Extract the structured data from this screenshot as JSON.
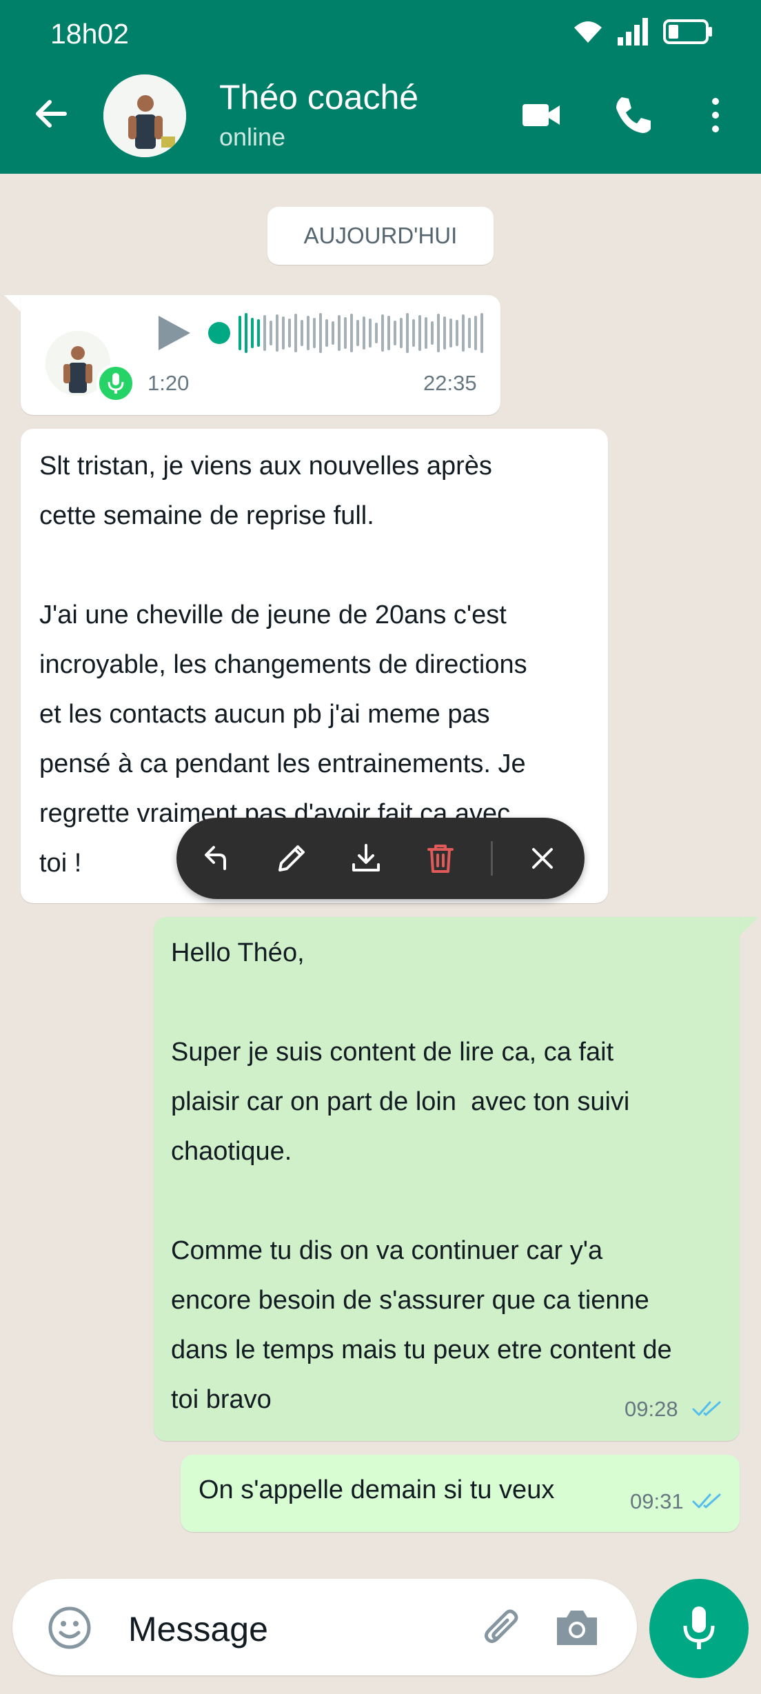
{
  "status_bar": {
    "time": "18h02"
  },
  "header": {
    "contact_name": "Théo coaché",
    "contact_status": "online"
  },
  "date_chip": "AUJOURD'HUI",
  "voice_note": {
    "duration": "1:20",
    "time": "22:35"
  },
  "messages": [
    {
      "direction": "incoming",
      "text": "Slt tristan, je viens aux nouvelles après\ncette semaine de reprise full.\n\nJ'ai une cheville de jeune de 20ans c'est\nincroyable, les changements de directions\net les contacts aucun pb j'ai meme pas\npensé à ca pendant les entrainements. Je\nregrette vraiment pas d'avoir fait ca avec\ntoi !"
    },
    {
      "direction": "outgoing",
      "text": "Hello Théo,\n\nSuper je suis content de lire ca, ca fait\nplaisir car on part de loin  avec ton suivi\nchaotique.\n\nComme tu dis on va continuer car y'a\nencore besoin de s'assurer que ca tienne\ndans le temps mais tu peux etre content de\ntoi bravo",
      "time": "09:28"
    },
    {
      "direction": "outgoing",
      "text": "On s'appelle demain si tu veux",
      "time": "09:31"
    }
  ],
  "composer": {
    "placeholder": "Message"
  },
  "colors": {
    "header": "#008069",
    "accent": "#00a884",
    "outgoing": "#d0f0c9",
    "read_tick": "#53bdeb",
    "delete": "#e05a5a"
  },
  "icons": [
    "back-arrow-icon",
    "video-call-icon",
    "phone-icon",
    "more-icon",
    "play-icon",
    "mic-icon",
    "reply-icon",
    "edit-icon",
    "download-icon",
    "delete-icon",
    "close-icon",
    "emoji-icon",
    "attach-icon",
    "camera-icon"
  ]
}
